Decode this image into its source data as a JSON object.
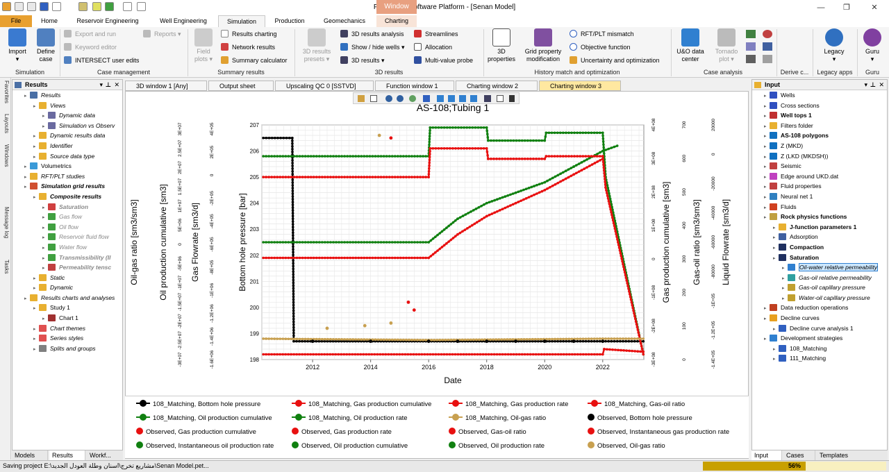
{
  "window": {
    "title": "Petrel E&P Software Platform - [Senan Model]",
    "context_tab": "Window",
    "controls": [
      "—",
      "❐",
      "✕"
    ]
  },
  "ribbon_tabs": [
    "File",
    "Home",
    "Reservoir Engineering",
    "Well Engineering",
    "Simulation",
    "Production",
    "Geomechanics",
    "Charting"
  ],
  "ribbon": {
    "simulation": {
      "import": "Import",
      "define_case_1": "Define",
      "define_case_2": "case",
      "label": "Simulation"
    },
    "case_management": {
      "export_and_run": "Export and run",
      "keyword_editor": "Keyword editor",
      "intersect_user_edits": "INTERSECT user edits",
      "reports": "Reports",
      "label": "Case management"
    },
    "summary_results": {
      "field_plots_1": "Field",
      "field_plots_2": "plots",
      "results_charting": "Results charting",
      "network_results": "Network results",
      "summary_calculator": "Summary calculator",
      "label": "Summary results"
    },
    "results_3d": {
      "presets_1": "3D results",
      "presets_2": "presets",
      "analysis": "3D results analysis",
      "show_hide_wells": "Show / hide wells",
      "results": "3D results",
      "streamlines": "Streamlines",
      "allocation": "Allocation",
      "multi_value_probe": "Multi-value probe",
      "label": "3D results"
    },
    "history_match": {
      "props_1": "3D",
      "props_2": "properties",
      "grid_mod_1": "Grid property",
      "grid_mod_2": "modification",
      "rft_plt_mismatch": "RFT/PLT mismatch",
      "objective_function": "Objective function",
      "uncertainty": "Uncertainty and optimization",
      "label": "History match and optimization"
    },
    "case_analysis": {
      "uo_1": "U&O data",
      "uo_2": "center",
      "tornado_1": "Tornado",
      "tornado_2": "plot",
      "label": "Case analysis"
    },
    "derive": {
      "label": "Derive c..."
    },
    "legacy": {
      "btn": "Legacy",
      "label": "Legacy apps"
    },
    "guru": {
      "btn": "Guru",
      "label": "Guru"
    }
  },
  "left_strip": [
    "Favorites",
    "Layouts",
    "Windows",
    "Message log",
    "Tasks"
  ],
  "results_panel": {
    "title": "Results",
    "items": [
      {
        "label": "Results",
        "indent": 1,
        "style": "it",
        "icon": "results-icon",
        "color": "#4a6fa5"
      },
      {
        "label": "Views",
        "indent": 2,
        "style": "it",
        "icon": "folder-icon",
        "color": "#e8b030"
      },
      {
        "label": "Dynamic data",
        "indent": 3,
        "style": "it",
        "icon": "chart-icon",
        "color": "#6a6aa0"
      },
      {
        "label": "Simulation vs Observ",
        "indent": 3,
        "style": "it",
        "icon": "chart-icon",
        "color": "#6a6aa0"
      },
      {
        "label": "Dynamic results data",
        "indent": 2,
        "style": "it",
        "icon": "folder-icon",
        "color": "#e8b030"
      },
      {
        "label": "Identifier",
        "indent": 2,
        "style": "it",
        "icon": "folder-icon",
        "color": "#e8b030"
      },
      {
        "label": "Source data type",
        "indent": 2,
        "style": "it",
        "icon": "folder-icon",
        "color": "#e8b030"
      },
      {
        "label": "Volumetrics",
        "indent": 1,
        "style": "",
        "icon": "cylinder-icon",
        "color": "#3a9ad8"
      },
      {
        "label": "RFT/PLT studies",
        "indent": 1,
        "style": "it",
        "icon": "folder-icon",
        "color": "#e8b030"
      },
      {
        "label": "Simulation grid results",
        "indent": 1,
        "style": "it bold",
        "icon": "grid-icon",
        "color": "#d05030"
      },
      {
        "label": "Composite results",
        "indent": 2,
        "style": "it bold",
        "icon": "folder-icon",
        "color": "#e8b030"
      },
      {
        "label": "Saturation",
        "indent": 3,
        "style": "it bold gr",
        "icon": "triangle-icon",
        "color": "#d04040"
      },
      {
        "label": "Gas flow",
        "indent": 3,
        "style": "it gr",
        "icon": "arrow-icon",
        "color": "#40a040"
      },
      {
        "label": "Oil flow",
        "indent": 3,
        "style": "it gr",
        "icon": "arrow-icon",
        "color": "#40a040"
      },
      {
        "label": "Reservoir fluid flow",
        "indent": 3,
        "style": "it gr",
        "icon": "arrow-icon",
        "color": "#40a040"
      },
      {
        "label": "Water flow",
        "indent": 3,
        "style": "it gr",
        "icon": "arrow-icon",
        "color": "#40a040"
      },
      {
        "label": "Transmissibility (Il",
        "indent": 3,
        "style": "it bold gr",
        "icon": "arrow-icon",
        "color": "#40a040"
      },
      {
        "label": "Permeability tensc",
        "indent": 3,
        "style": "it bold gr",
        "icon": "tensor-icon",
        "color": "#c04040"
      },
      {
        "label": "Static",
        "indent": 2,
        "style": "it",
        "icon": "folder-icon",
        "color": "#e8b030"
      },
      {
        "label": "Dynamic",
        "indent": 2,
        "style": "it",
        "icon": "folder-icon",
        "color": "#e8b030"
      },
      {
        "label": "Results charts and analyses",
        "indent": 1,
        "style": "it",
        "icon": "folder-icon",
        "color": "#e8b030"
      },
      {
        "label": "Study 1",
        "indent": 2,
        "style": "",
        "icon": "folder-icon",
        "color": "#e8b030"
      },
      {
        "label": "Chart 1",
        "indent": 3,
        "style": "",
        "icon": "chart-icon",
        "color": "#a03030"
      },
      {
        "label": "Chart themes",
        "indent": 2,
        "style": "it",
        "icon": "theme-icon",
        "color": "#e05050"
      },
      {
        "label": "Series styles",
        "indent": 2,
        "style": "it",
        "icon": "theme-icon",
        "color": "#e05050"
      },
      {
        "label": "Splits and groups",
        "indent": 2,
        "style": "it",
        "icon": "theme-icon",
        "color": "#808080"
      }
    ]
  },
  "left_bottom_tabs": [
    "Models",
    "Results",
    "Workf..."
  ],
  "doc_tabs": [
    "3D window 1 [Any]",
    "Output sheet",
    "Upscaling QC 0 [SSTVD]",
    "Function window 1",
    "Charting window 2",
    "Charting window 3"
  ],
  "chart_data": {
    "type": "line",
    "title": "AS-108;Tubing 1",
    "xlabel": "Date",
    "x_range": [
      "2010-04",
      "2023-06"
    ],
    "x_ticks": [
      "2012",
      "2014",
      "2016",
      "2018",
      "2020",
      "2022"
    ],
    "primary_axis": {
      "label": "Bottom hole pressure [bar]",
      "range": [
        198,
        207
      ],
      "ticks": [
        "198",
        "199",
        "200",
        "201",
        "202",
        "203",
        "204",
        "205",
        "206",
        "207"
      ]
    },
    "other_axes": [
      {
        "label": "Oil-gas ratio [sm3/sm3]",
        "side": "left",
        "ticks": []
      },
      {
        "label": "Oil production cumulative [sm3]",
        "side": "left",
        "ticks": [
          "3E+07",
          "2.5E+07",
          "2E+07",
          "1.5E+07",
          "1E+07",
          "5E+06",
          "0",
          "-5E+06",
          "-1E+07",
          "-1.5E+07",
          "-2E+07",
          "-2.5E+07",
          "-3E+07"
        ]
      },
      {
        "label": "Gas Flowrate [sm3/d]",
        "side": "left",
        "ticks": [
          "4E+05",
          "2E+05",
          "0",
          "-2E+05",
          "-4E+05",
          "-6E+05",
          "-8E+05",
          "-1E+06",
          "-1.2E+06",
          "-1.4E+06",
          "-1.6E+06"
        ]
      },
      {
        "label": "Gas production cumulative [sm3]",
        "side": "right",
        "ticks": [
          "4E+08",
          "3E+08",
          "2E+08",
          "1E+08",
          "0",
          "-1E+08",
          "-2E+08",
          "-3E+08"
        ]
      },
      {
        "label": "Gas-oil ratio [sm3/sm3]",
        "side": "right",
        "ticks": [
          "700",
          "600",
          "500",
          "400",
          "300",
          "200",
          "100",
          "0"
        ]
      },
      {
        "label": "Liquid Flowrate [sm3/d]",
        "side": "right",
        "ticks": [
          "20000",
          "0",
          "-20000",
          "-40000",
          "-60000",
          "-80000",
          "-1E+05",
          "-1.2E+05",
          "-1.4E+05"
        ]
      }
    ],
    "grid": true,
    "series": [
      {
        "name": "108_Matching, Bottom hole pressure",
        "color": "#000000",
        "x": [
          2010.3,
          2011.3,
          2011.35,
          2016,
          2022,
          2023.4
        ],
        "y": [
          206.5,
          206.5,
          198.7,
          198.7,
          198.7,
          198.7
        ]
      },
      {
        "name": "108_Matching, Oil production rate",
        "color": "#108010",
        "x": [
          2010.3,
          2016,
          2016.05,
          2018,
          2018.05,
          2020,
          2020.05,
          2022,
          2022.1,
          2023.4
        ],
        "y": [
          205.8,
          205.8,
          206.9,
          206.9,
          206.4,
          206.4,
          206.7,
          206.7,
          205,
          198.2
        ]
      },
      {
        "name": "108_Matching, Oil production cumulative",
        "color": "#108010",
        "x": [
          2010.3,
          2016,
          2017,
          2018,
          2019,
          2020,
          2021,
          2022,
          2022.5
        ],
        "y": [
          202.5,
          202.5,
          203.4,
          204,
          204.4,
          204.8,
          205.4,
          206,
          206.2
        ]
      },
      {
        "name": "108_Matching, Gas production rate",
        "color": "#e81010",
        "x": [
          2010.3,
          2016,
          2016.05,
          2018,
          2018.05,
          2020,
          2020.05,
          2022,
          2022.1,
          2023.4
        ],
        "y": [
          205,
          205,
          206.1,
          206.1,
          205.7,
          205.7,
          205.8,
          205.8,
          204.6,
          198.2
        ]
      },
      {
        "name": "108_Matching, Gas production cumulative",
        "color": "#e81010",
        "x": [
          2010.3,
          2016,
          2017,
          2018,
          2019,
          2020,
          2021,
          2022
        ],
        "y": [
          201.9,
          201.9,
          202.8,
          203.5,
          204,
          204.5,
          205.1,
          205.7
        ]
      },
      {
        "name": "108_Matching, Gas-oil ratio",
        "color": "#e81010",
        "x": [
          2010.3,
          2022,
          2022.05,
          2023.4
        ],
        "y": [
          198.2,
          198.2,
          198.4,
          198.3
        ]
      },
      {
        "name": "108_Matching, Oil-gas ratio",
        "color": "#c8a050",
        "x": [
          2010.3,
          2016,
          2022,
          2023.4
        ],
        "y": [
          198.8,
          198.75,
          198.8,
          198.8
        ]
      },
      {
        "name": "Observed, Bottom hole pressure",
        "color": "#000000",
        "x": [
          2012,
          2014,
          2016,
          2017,
          2018,
          2019,
          2020,
          2021,
          2022
        ],
        "y": [
          198.7,
          198.7,
          198.7,
          198.7,
          198.7,
          198.7,
          198.7,
          198.7,
          198.7
        ]
      },
      {
        "name": "Observed, Oil-gas ratio",
        "color": "#c8a050",
        "x": [
          2014.3,
          2013.8,
          2012.5,
          2014.7
        ],
        "y": [
          206.6,
          199.3,
          199.2,
          199.4
        ]
      },
      {
        "name": "Observed, Gas-oil ratio",
        "color": "#e81010",
        "x": [
          2014.7,
          2015.3,
          2015.5
        ],
        "y": [
          206.5,
          200.2,
          199.9
        ]
      }
    ]
  },
  "legend": [
    {
      "label": "108_Matching, Bottom hole pressure",
      "color": "#000000",
      "kind": "line"
    },
    {
      "label": "108_Matching, Gas production cumulative",
      "color": "#e81010",
      "kind": "line"
    },
    {
      "label": "108_Matching, Gas production rate",
      "color": "#e81010",
      "kind": "line"
    },
    {
      "label": "108_Matching, Gas-oil ratio",
      "color": "#e81010",
      "kind": "line"
    },
    {
      "label": "108_Matching, Oil production cumulative",
      "color": "#108010",
      "kind": "line"
    },
    {
      "label": "108_Matching, Oil production rate",
      "color": "#108010",
      "kind": "line"
    },
    {
      "label": "108_Matching, Oil-gas ratio",
      "color": "#c8a050",
      "kind": "line"
    },
    {
      "label": "Observed, Bottom hole pressure",
      "color": "#000000",
      "kind": "dot"
    },
    {
      "label": "Observed, Gas production cumulative",
      "color": "#e81010",
      "kind": "dot"
    },
    {
      "label": "Observed, Gas production rate",
      "color": "#e81010",
      "kind": "dot"
    },
    {
      "label": "Observed, Gas-oil ratio",
      "color": "#e81010",
      "kind": "dot"
    },
    {
      "label": "Observed, Instantaneous gas production rate",
      "color": "#e81010",
      "kind": "dot"
    },
    {
      "label": "Observed, Instantaneous oil production rate",
      "color": "#108010",
      "kind": "dot"
    },
    {
      "label": "Observed, Oil production cumulative",
      "color": "#108010",
      "kind": "dot"
    },
    {
      "label": "Observed, Oil production rate",
      "color": "#108010",
      "kind": "dot"
    },
    {
      "label": "Observed, Oil-gas ratio",
      "color": "#c8a050",
      "kind": "dot"
    }
  ],
  "input_panel": {
    "title": "Input",
    "items": [
      {
        "label": "Wells",
        "indent": 1,
        "style": "",
        "icon": "wells-icon",
        "color": "#3050c0"
      },
      {
        "label": "Cross sections",
        "indent": 1,
        "style": "",
        "icon": "cross-section-icon",
        "color": "#3050c0"
      },
      {
        "label": "Well tops 1",
        "indent": 1,
        "style": "bold",
        "icon": "well-tops-icon",
        "color": "#c03030"
      },
      {
        "label": "Filters folder",
        "indent": 1,
        "style": "",
        "icon": "filter-icon",
        "color": "#e8b030"
      },
      {
        "label": "AS-108 polygons",
        "indent": 1,
        "style": "bold",
        "icon": "polygon-icon",
        "color": "#1070c0"
      },
      {
        "label": "Z (MKD)",
        "indent": 1,
        "style": "",
        "icon": "surface-icon",
        "color": "#1070c0"
      },
      {
        "label": "Z (LKD (MKDSH))",
        "indent": 1,
        "style": "",
        "icon": "surface-icon",
        "color": "#1070c0"
      },
      {
        "label": "Seismic",
        "indent": 1,
        "style": "",
        "icon": "seismic-icon",
        "color": "#c04040"
      },
      {
        "label": "Edge around UKD.dat",
        "indent": 1,
        "style": "",
        "icon": "ring-icon",
        "color": "#c040c0"
      },
      {
        "label": "Fluid properties",
        "indent": 1,
        "style": "",
        "icon": "fluid-icon",
        "color": "#c04040"
      },
      {
        "label": "Neural net 1",
        "indent": 1,
        "style": "",
        "icon": "neural-icon",
        "color": "#3080c0"
      },
      {
        "label": "Fluids",
        "indent": 1,
        "style": "",
        "icon": "drop-icon",
        "color": "#d04020"
      },
      {
        "label": "Rock physics functions",
        "indent": 1,
        "style": "bold",
        "icon": "rock-icon",
        "color": "#c0a040"
      },
      {
        "label": "J-function parameters 1",
        "indent": 2,
        "style": "bold",
        "icon": "j-icon",
        "color": "#e8b030"
      },
      {
        "label": "Adsorption",
        "indent": 2,
        "style": "",
        "icon": "adsorption-icon",
        "color": "#4060a0"
      },
      {
        "label": "Compaction",
        "indent": 2,
        "style": "bold",
        "icon": "compaction-icon",
        "color": "#203060"
      },
      {
        "label": "Saturation",
        "indent": 2,
        "style": "bold",
        "icon": "saturation-icon",
        "color": "#203060"
      },
      {
        "label": "Oil-water relative permeability",
        "indent": 3,
        "style": "it sel",
        "icon": "curve-icon",
        "color": "#3080d0"
      },
      {
        "label": "Gas-oil relative permeability",
        "indent": 3,
        "style": "it",
        "icon": "curve-icon",
        "color": "#30a0a0"
      },
      {
        "label": "Gas-oil capillary pressure",
        "indent": 3,
        "style": "it",
        "icon": "curve-icon",
        "color": "#c0a030"
      },
      {
        "label": "Water-oil capillary pressure",
        "indent": 3,
        "style": "it",
        "icon": "curve-icon",
        "color": "#c0a030"
      },
      {
        "label": "Data reduction operations",
        "indent": 1,
        "style": "",
        "icon": "data-reduction-icon",
        "color": "#c04020"
      },
      {
        "label": "Decline curves",
        "indent": 1,
        "style": "",
        "icon": "dc-icon",
        "color": "#e8a020"
      },
      {
        "label": "Decline curve analysis 1",
        "indent": 2,
        "style": "",
        "icon": "dca-icon",
        "color": "#3060c0"
      },
      {
        "label": "Development strategies",
        "indent": 1,
        "style": "",
        "icon": "folder-icon",
        "color": "#3080d0"
      },
      {
        "label": "108_Matching",
        "indent": 2,
        "style": "",
        "icon": "strategy-icon",
        "color": "#3060c0"
      },
      {
        "label": "111_Matching",
        "indent": 2,
        "style": "",
        "icon": "strategy-icon",
        "color": "#3060c0"
      }
    ]
  },
  "right_bottom_tabs": [
    "Input",
    "Cases",
    "Templates"
  ],
  "status": {
    "text": "Saving project E:\\مشاريع تخرج\\اسنان وطلة العودل الجديد\\Senan Model.pet...",
    "progress_label": "56%",
    "progress": 0.56
  }
}
